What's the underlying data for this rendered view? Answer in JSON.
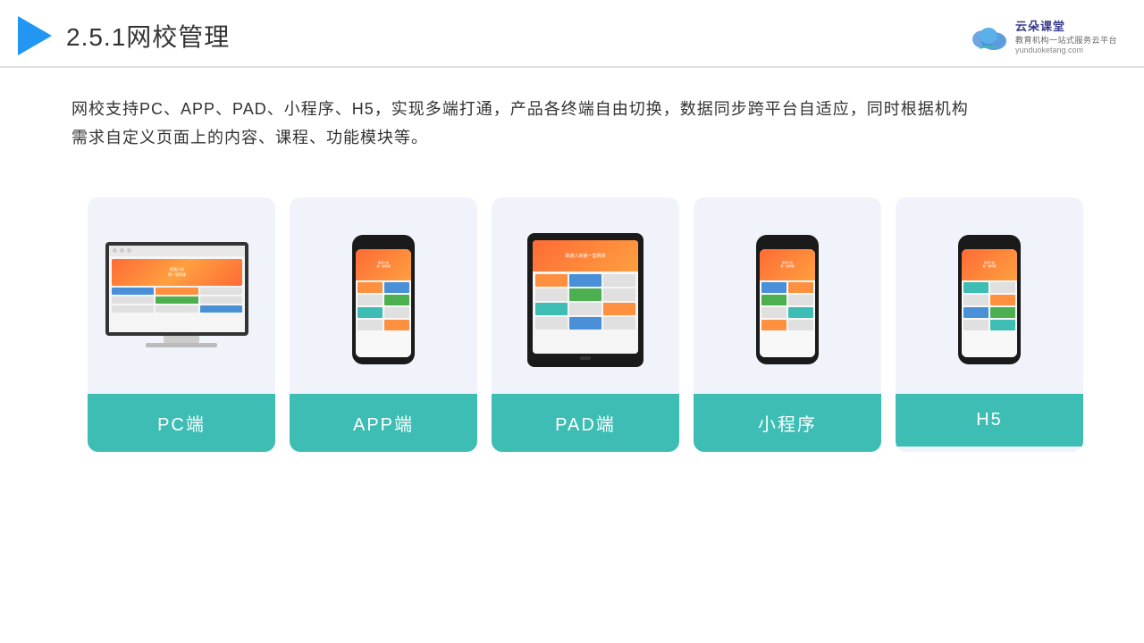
{
  "header": {
    "title": "2.5.1网校管理",
    "brand": {
      "name": "云朵课堂",
      "tagline": "教育机构一站式服务云平台",
      "url": "yunduoketang.com"
    }
  },
  "description": {
    "text": "网校支持PC、APP、PAD、小程序、H5，实现多端打通，产品各终端自由切换，数据同步跨平台自适应，同时根据机构需求自定义页面上的内容、课程、功能模块等。"
  },
  "cards": [
    {
      "label": "PC端",
      "type": "pc"
    },
    {
      "label": "APP端",
      "type": "phone"
    },
    {
      "label": "PAD端",
      "type": "tablet"
    },
    {
      "label": "小程序",
      "type": "phone"
    },
    {
      "label": "H5",
      "type": "phone"
    }
  ],
  "colors": {
    "accent": "#3DBDB3",
    "title_blue": "#2196F3",
    "brand_blue": "#3a3a8c"
  }
}
